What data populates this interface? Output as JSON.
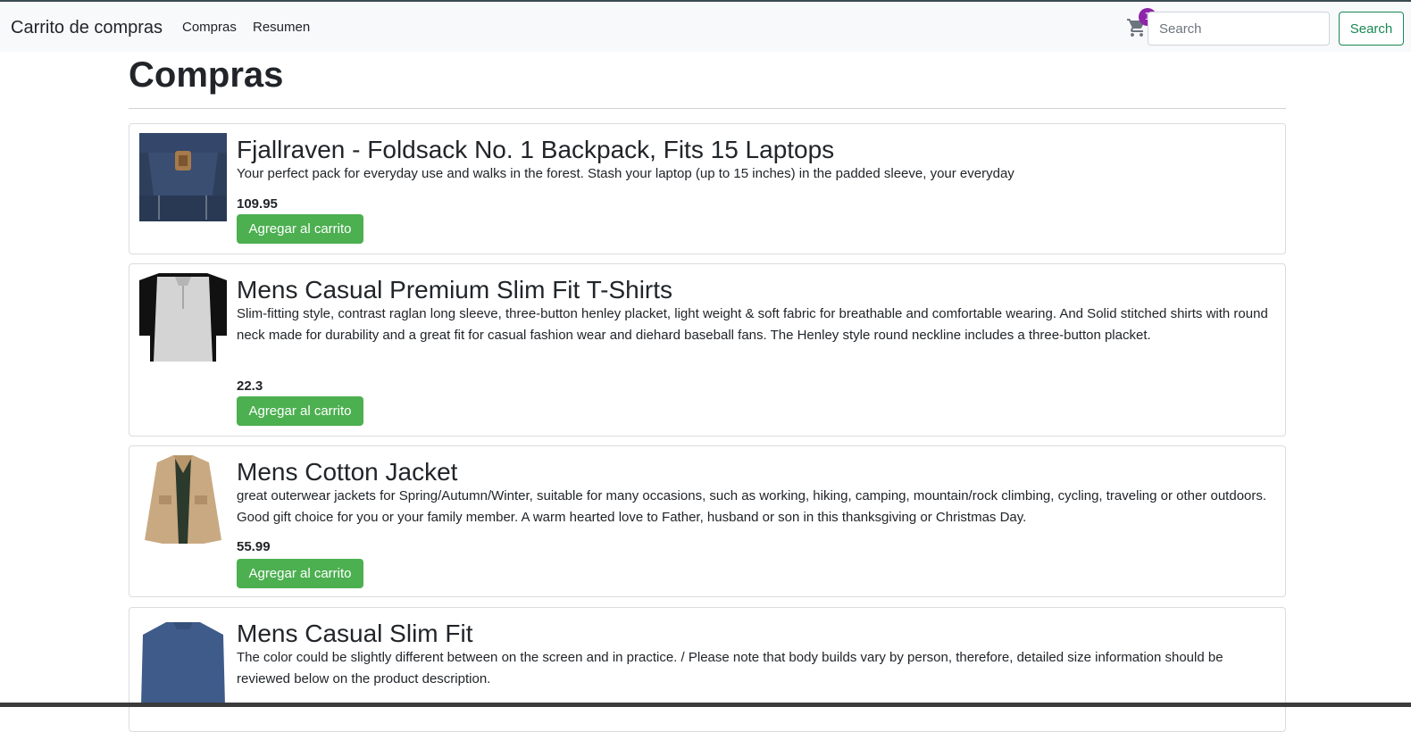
{
  "navbar": {
    "brand": "Carrito de compras",
    "links": [
      "Compras",
      "Resumen"
    ],
    "cart_count": "1",
    "search_placeholder": "Search",
    "search_button": "Search",
    "colors": {
      "badge": "#8e24aa",
      "search_outline": "#198754"
    }
  },
  "page": {
    "title": "Compras"
  },
  "products": [
    {
      "title": "Fjallraven - Foldsack No. 1 Backpack, Fits 15 Laptops",
      "description": "Your perfect pack for everyday use and walks in the forest. Stash your laptop (up to 15 inches) in the padded sleeve, your everyday",
      "price": "109.95",
      "button": "Agregar al carrito",
      "image": "backpack-image"
    },
    {
      "title": "Mens Casual Premium Slim Fit T-Shirts",
      "description": "Slim-fitting style, contrast raglan long sleeve, three-button henley placket, light weight & soft fabric for breathable and comfortable wearing. And Solid stitched shirts with round neck made for durability and a great fit for casual fashion wear and diehard baseball fans. The Henley style round neckline includes a three-button placket.",
      "price": "22.3",
      "button": "Agregar al carrito",
      "image": "tshirt-image"
    },
    {
      "title": "Mens Cotton Jacket",
      "description": "great outerwear jackets for Spring/Autumn/Winter, suitable for many occasions, such as working, hiking, camping, mountain/rock climbing, cycling, traveling or other outdoors. Good gift choice for you or your family member. A warm hearted love to Father, husband or son in this thanksgiving or Christmas Day.",
      "price": "55.99",
      "button": "Agregar al carrito",
      "image": "jacket-image"
    },
    {
      "title": "Mens Casual Slim Fit",
      "description": "The color could be slightly different between on the screen and in practice. / Please note that body builds vary by person, therefore, detailed size information should be reviewed below on the product description.",
      "image": "long-sleeve-shirt-image"
    }
  ],
  "colors": {
    "add_button": "#4caf50"
  }
}
